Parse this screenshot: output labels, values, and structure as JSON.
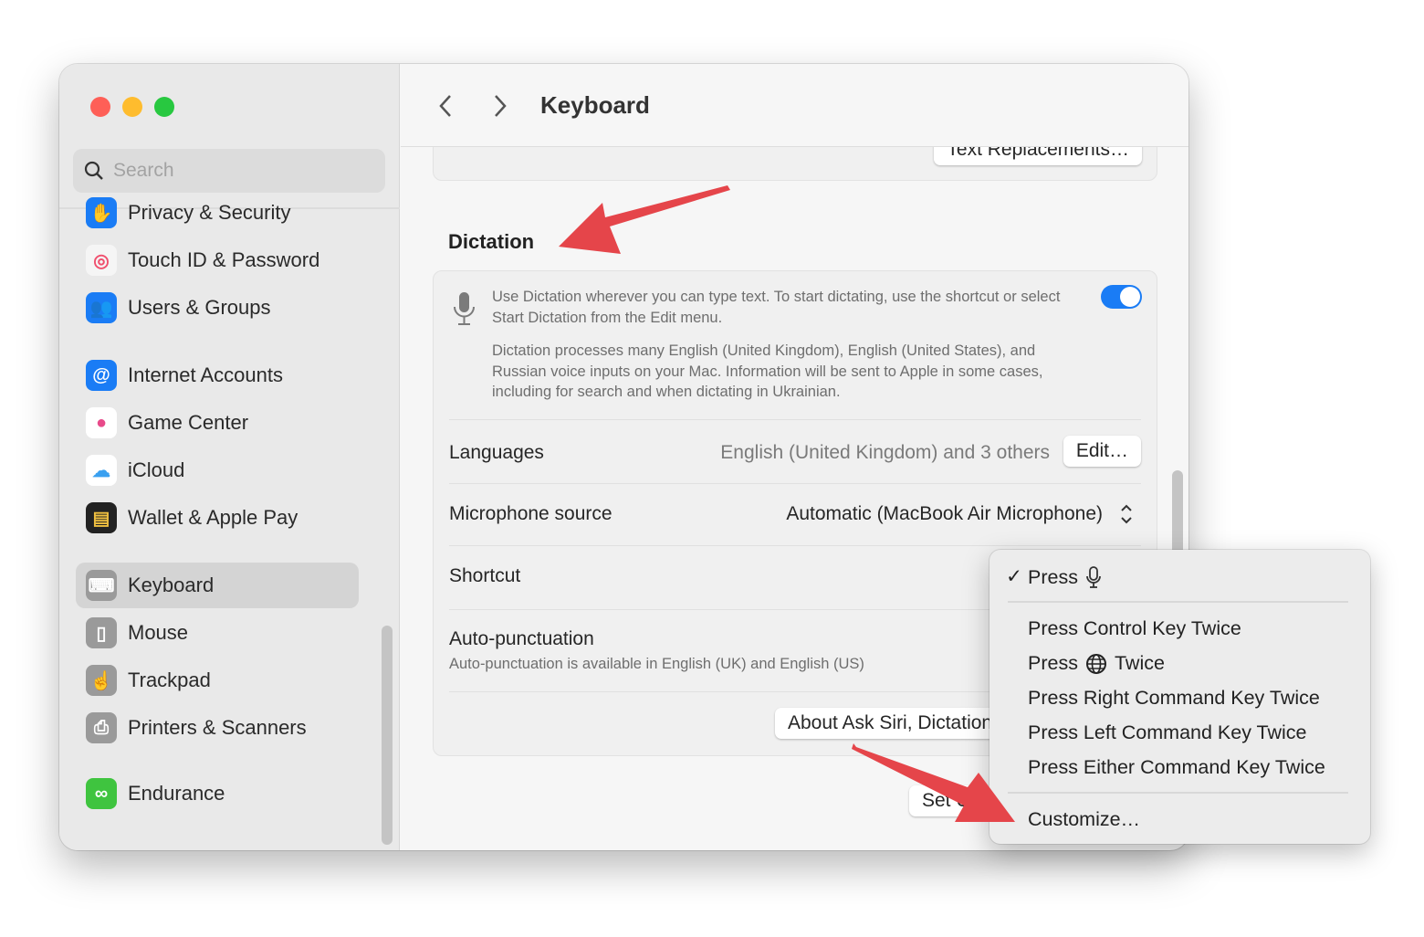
{
  "sidebar": {
    "search_placeholder": "Search",
    "items": [
      {
        "label": "Privacy & Security",
        "icon": "hand-icon",
        "color": "#1a7cf5"
      },
      {
        "label": "Touch ID & Password",
        "icon": "fingerprint-icon",
        "color": "#f5f5f5"
      },
      {
        "label": "Users & Groups",
        "icon": "users-icon",
        "color": "#1a7cf5"
      },
      {
        "label": "Internet Accounts",
        "icon": "at-icon",
        "color": "#1a7cf5"
      },
      {
        "label": "Game Center",
        "icon": "game-center-icon",
        "color": "#ffffff"
      },
      {
        "label": "iCloud",
        "icon": "cloud-icon",
        "color": "#ffffff"
      },
      {
        "label": "Wallet & Apple Pay",
        "icon": "wallet-icon",
        "color": "#222222"
      },
      {
        "label": "Keyboard",
        "icon": "keyboard-icon",
        "color": "#9a9a9a",
        "selected": true
      },
      {
        "label": "Mouse",
        "icon": "mouse-icon",
        "color": "#9a9a9a"
      },
      {
        "label": "Trackpad",
        "icon": "trackpad-icon",
        "color": "#9a9a9a"
      },
      {
        "label": "Printers & Scanners",
        "icon": "printer-icon",
        "color": "#9a9a9a"
      },
      {
        "label": "Endurance",
        "icon": "endurance-icon",
        "color": "#3fc43f"
      }
    ]
  },
  "header": {
    "title": "Keyboard"
  },
  "main": {
    "text_replacements_button": "Text Replacements…",
    "dictation": {
      "heading": "Dictation",
      "toggle_on": true,
      "description": "Use Dictation wherever you can type text. To start dictating, use the shortcut or select Start Dictation from the Edit menu.",
      "privacy": "Dictation processes many English (United Kingdom), English (United States), and Russian voice inputs on your Mac. Information will be sent to Apple in some cases, including for search and when dictating in Ukrainian.",
      "languages_label": "Languages",
      "languages_value": "English (United Kingdom) and 3 others",
      "edit_button": "Edit…",
      "mic_label": "Microphone source",
      "mic_value": "Automatic (MacBook Air Microphone)",
      "shortcut_label": "Shortcut",
      "autopunct_label": "Auto-punctuation",
      "autopunct_desc": "Auto-punctuation is available in English (UK) and English (US)",
      "about_button": "About Ask Siri, Dictation & Privacy…",
      "setup_button": "Set Up Keyboard…"
    }
  },
  "menu": {
    "checked": "Press",
    "items": [
      "Press Control Key Twice",
      "Press",
      "Twice",
      "Press Right Command Key Twice",
      "Press Left Command Key Twice",
      "Press Either Command Key Twice"
    ],
    "customize": "Customize…"
  },
  "colors": {
    "accent": "#1a7cf5",
    "arrow": "#e5454a"
  }
}
